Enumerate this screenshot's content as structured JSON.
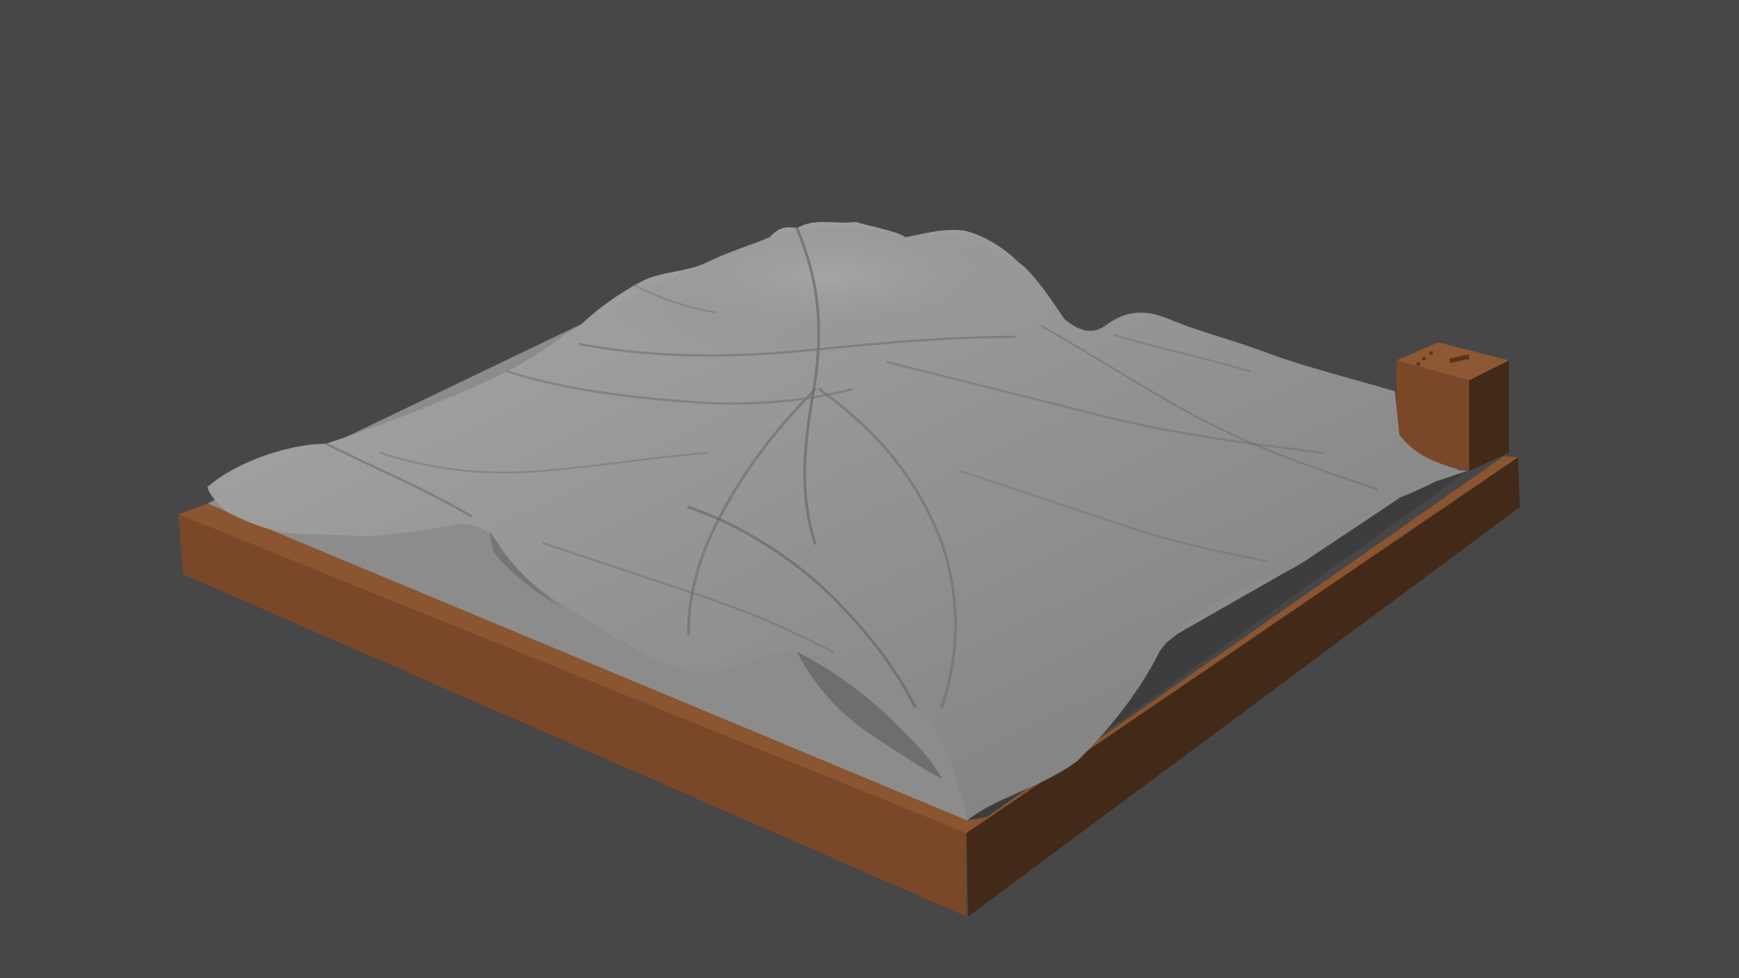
{
  "viewport": {
    "background_color": "#474747",
    "object": "terrain-relief-model"
  },
  "colors": {
    "base_front": "#7a4828",
    "base_right": "#432a18",
    "base_top": "#8a5530",
    "terrain_light": "#a3a3a3",
    "terrain_mid": "#8f8f8f",
    "terrain_dark": "#5f5f5f",
    "plate": "#8a8a8a",
    "shadow": "#3a3a3a"
  }
}
